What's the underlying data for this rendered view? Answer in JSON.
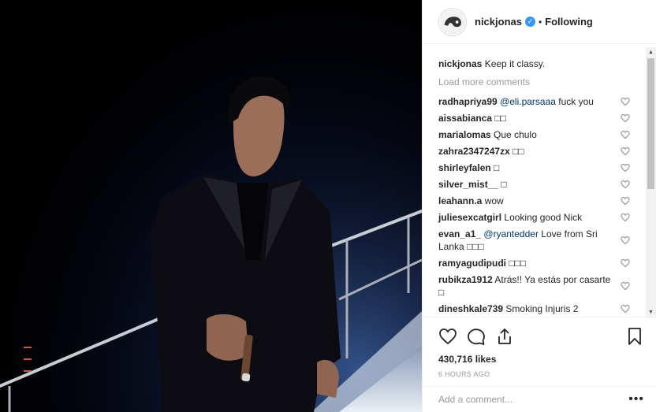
{
  "post": {
    "username": "nickjonas",
    "follow_label": "Following",
    "separator": "•",
    "verified_glyph": "✓"
  },
  "caption": {
    "user": "nickjonas",
    "text": "Keep it classy."
  },
  "load_more": "Load more comments",
  "comments": [
    {
      "user": "radhapriya99",
      "mention": "@eli.parsaaa",
      "text": " fuck you"
    },
    {
      "user": "aissabianca",
      "mention": "",
      "text": "□□"
    },
    {
      "user": "marialomas",
      "mention": "",
      "text": "Que chulo"
    },
    {
      "user": "zahra2347247zx",
      "mention": "",
      "text": "□□"
    },
    {
      "user": "shirleyfalen",
      "mention": "",
      "text": "□"
    },
    {
      "user": "silver_mist__",
      "mention": "",
      "text": "□"
    },
    {
      "user": "leahann.a",
      "mention": "",
      "text": "wow"
    },
    {
      "user": "juliesexcatgirl",
      "mention": "",
      "text": "Looking good Nick"
    },
    {
      "user": "evan_a1_",
      "mention": "@ryantedder",
      "text": " Love from Sri Lanka □□□"
    },
    {
      "user": "ramyagudipudi",
      "mention": "",
      "text": "□□□"
    },
    {
      "user": "rubikza1912",
      "mention": "",
      "text": "Atrás!! Ya estás por casarte □"
    },
    {
      "user": "dineshkale739",
      "mention": "",
      "text": "Smoking Injuris 2"
    }
  ],
  "likes": "430,716 likes",
  "time": "6 HOURS AGO",
  "add_comment_placeholder": "Add a comment...",
  "more_glyph": "•••",
  "scroll_up": "▲",
  "scroll_down": "▼",
  "colors": {
    "link": "#003569",
    "muted": "#999999",
    "verified": "#3897f0",
    "border": "#efefef"
  },
  "icons": [
    "heart-icon",
    "comment-icon",
    "share-icon",
    "bookmark-icon"
  ]
}
